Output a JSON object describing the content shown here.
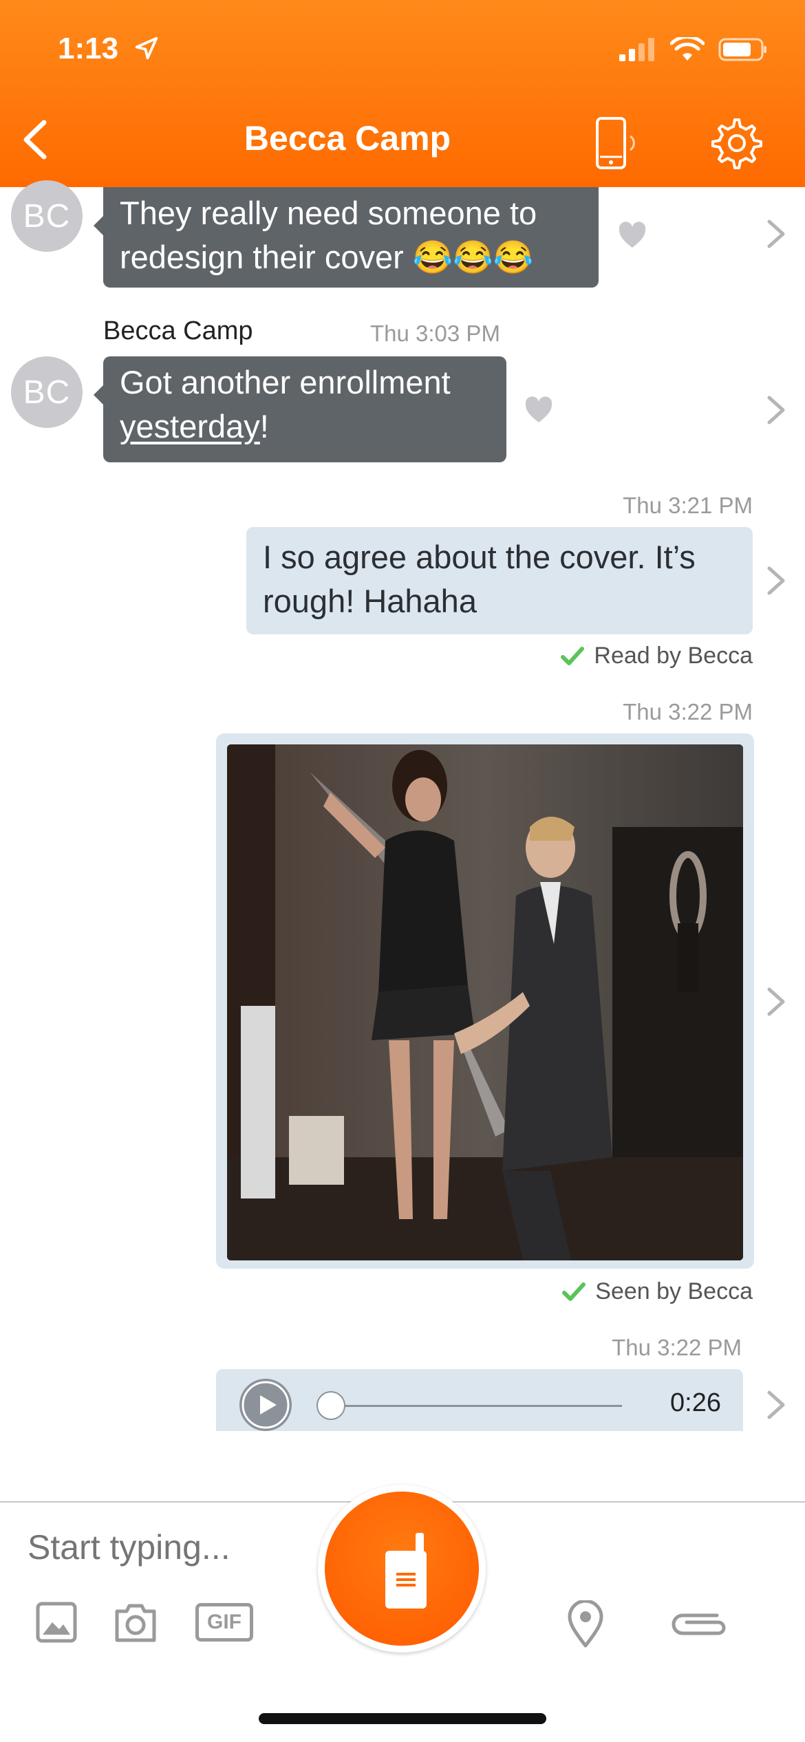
{
  "status_bar": {
    "time": "1:13"
  },
  "header": {
    "title": "Becca Camp"
  },
  "messages": [
    {
      "avatar": "BC",
      "text": "They really need someone to redesign their cover 😂😂😂"
    },
    {
      "sender": "Becca Camp",
      "time": "Thu 3:03 PM",
      "avatar": "BC",
      "text_part1": "Got another enrollment",
      "text_link": "yesterday",
      "text_part2": "!"
    },
    {
      "time": "Thu 3:21 PM",
      "text": "I so agree about the cover. It’s rough! Hahaha",
      "receipt": "Read by Becca"
    },
    {
      "time": "Thu 3:22 PM",
      "receipt": "Seen by Becca"
    },
    {
      "time": "Thu 3:22 PM",
      "duration": "0:26",
      "progress": 0
    }
  ],
  "composer": {
    "placeholder": "Start typing...",
    "gif_label": "GIF"
  },
  "colors": {
    "accent": "#ff6a00",
    "incoming_bubble": "#5f6469",
    "outgoing_bubble": "#dce6ee",
    "read_check": "#5cc35a"
  },
  "icons": [
    "back-icon",
    "phone-vibrate-icon",
    "gear-icon",
    "heart-icon",
    "chevron-right-icon",
    "play-icon",
    "image-icon",
    "camera-icon",
    "gif-icon",
    "walkie-talkie-icon",
    "location-pin-icon",
    "paperclip-icon"
  ]
}
